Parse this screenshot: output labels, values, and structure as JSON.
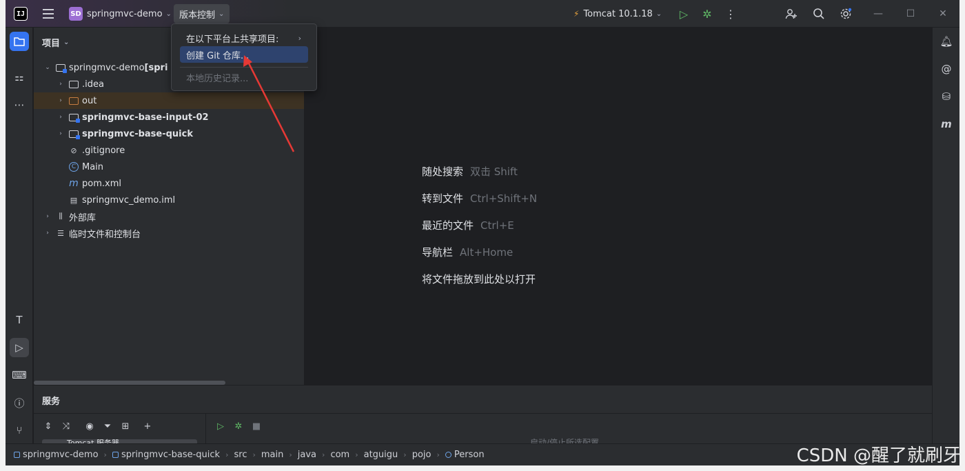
{
  "titlebar": {
    "app_logo": "IJ",
    "project_badge": "SD",
    "project_name": "springmvc-demo",
    "vcs_menu_label": "版本控制",
    "run_config": "Tomcat 10.1.18"
  },
  "vcs_menu": {
    "items": [
      {
        "label": "在以下平台上共享项目:",
        "has_submenu": true,
        "state": "normal"
      },
      {
        "label": "创建 Git 仓库...",
        "state": "selected"
      },
      {
        "label": "本地历史记录...",
        "state": "disabled"
      }
    ]
  },
  "project_panel": {
    "title": "项目",
    "tree": [
      {
        "label": "springmvc-demo",
        "suffix": " [spri",
        "depth": 0,
        "expanded": true,
        "icon": "module-folder-icon",
        "bold": false
      },
      {
        "label": ".idea",
        "depth": 1,
        "expanded": false,
        "icon": "folder-icon"
      },
      {
        "label": "out",
        "depth": 1,
        "expanded": false,
        "icon": "excluded-folder-icon",
        "highlight": true
      },
      {
        "label": "springmvc-base-input-02",
        "depth": 1,
        "expanded": false,
        "icon": "module-folder-icon",
        "bold": true
      },
      {
        "label": "springmvc-base-quick",
        "depth": 1,
        "expanded": false,
        "icon": "module-folder-icon",
        "bold": true
      },
      {
        "label": ".gitignore",
        "depth": 1,
        "icon": "ignore-file-icon"
      },
      {
        "label": "Main",
        "depth": 1,
        "icon": "class-icon"
      },
      {
        "label": "pom.xml",
        "depth": 1,
        "icon": "maven-icon"
      },
      {
        "label": "springmvc_demo.iml",
        "depth": 1,
        "icon": "iml-file-icon"
      },
      {
        "label": "外部库",
        "depth": 0,
        "expanded": false,
        "icon": "library-icon"
      },
      {
        "label": "临时文件和控制台",
        "depth": 0,
        "expanded": false,
        "icon": "scratch-icon"
      }
    ]
  },
  "editor_hints": [
    {
      "action": "随处搜索",
      "shortcut": "双击 Shift"
    },
    {
      "action": "转到文件",
      "shortcut": "Ctrl+Shift+N"
    },
    {
      "action": "最近的文件",
      "shortcut": "Ctrl+E"
    },
    {
      "action": "导航栏",
      "shortcut": "Alt+Home"
    },
    {
      "action": "将文件拖放到此处以打开",
      "shortcut": ""
    }
  ],
  "services": {
    "title": "服务",
    "row_label": "Tomcat 服务器",
    "hint": "启动/停止所选配置"
  },
  "breadcrumb": [
    "springmvc-demo",
    "springmvc-base-quick",
    "src",
    "main",
    "java",
    "com",
    "atguigu",
    "pojo",
    "Person"
  ],
  "watermark": "CSDN @醒了就刷牙",
  "colors": {
    "accent": "#3574f0",
    "run_green": "#5fb865",
    "menu_selected": "#2e436e",
    "annotation_arrow": "#e53935"
  }
}
